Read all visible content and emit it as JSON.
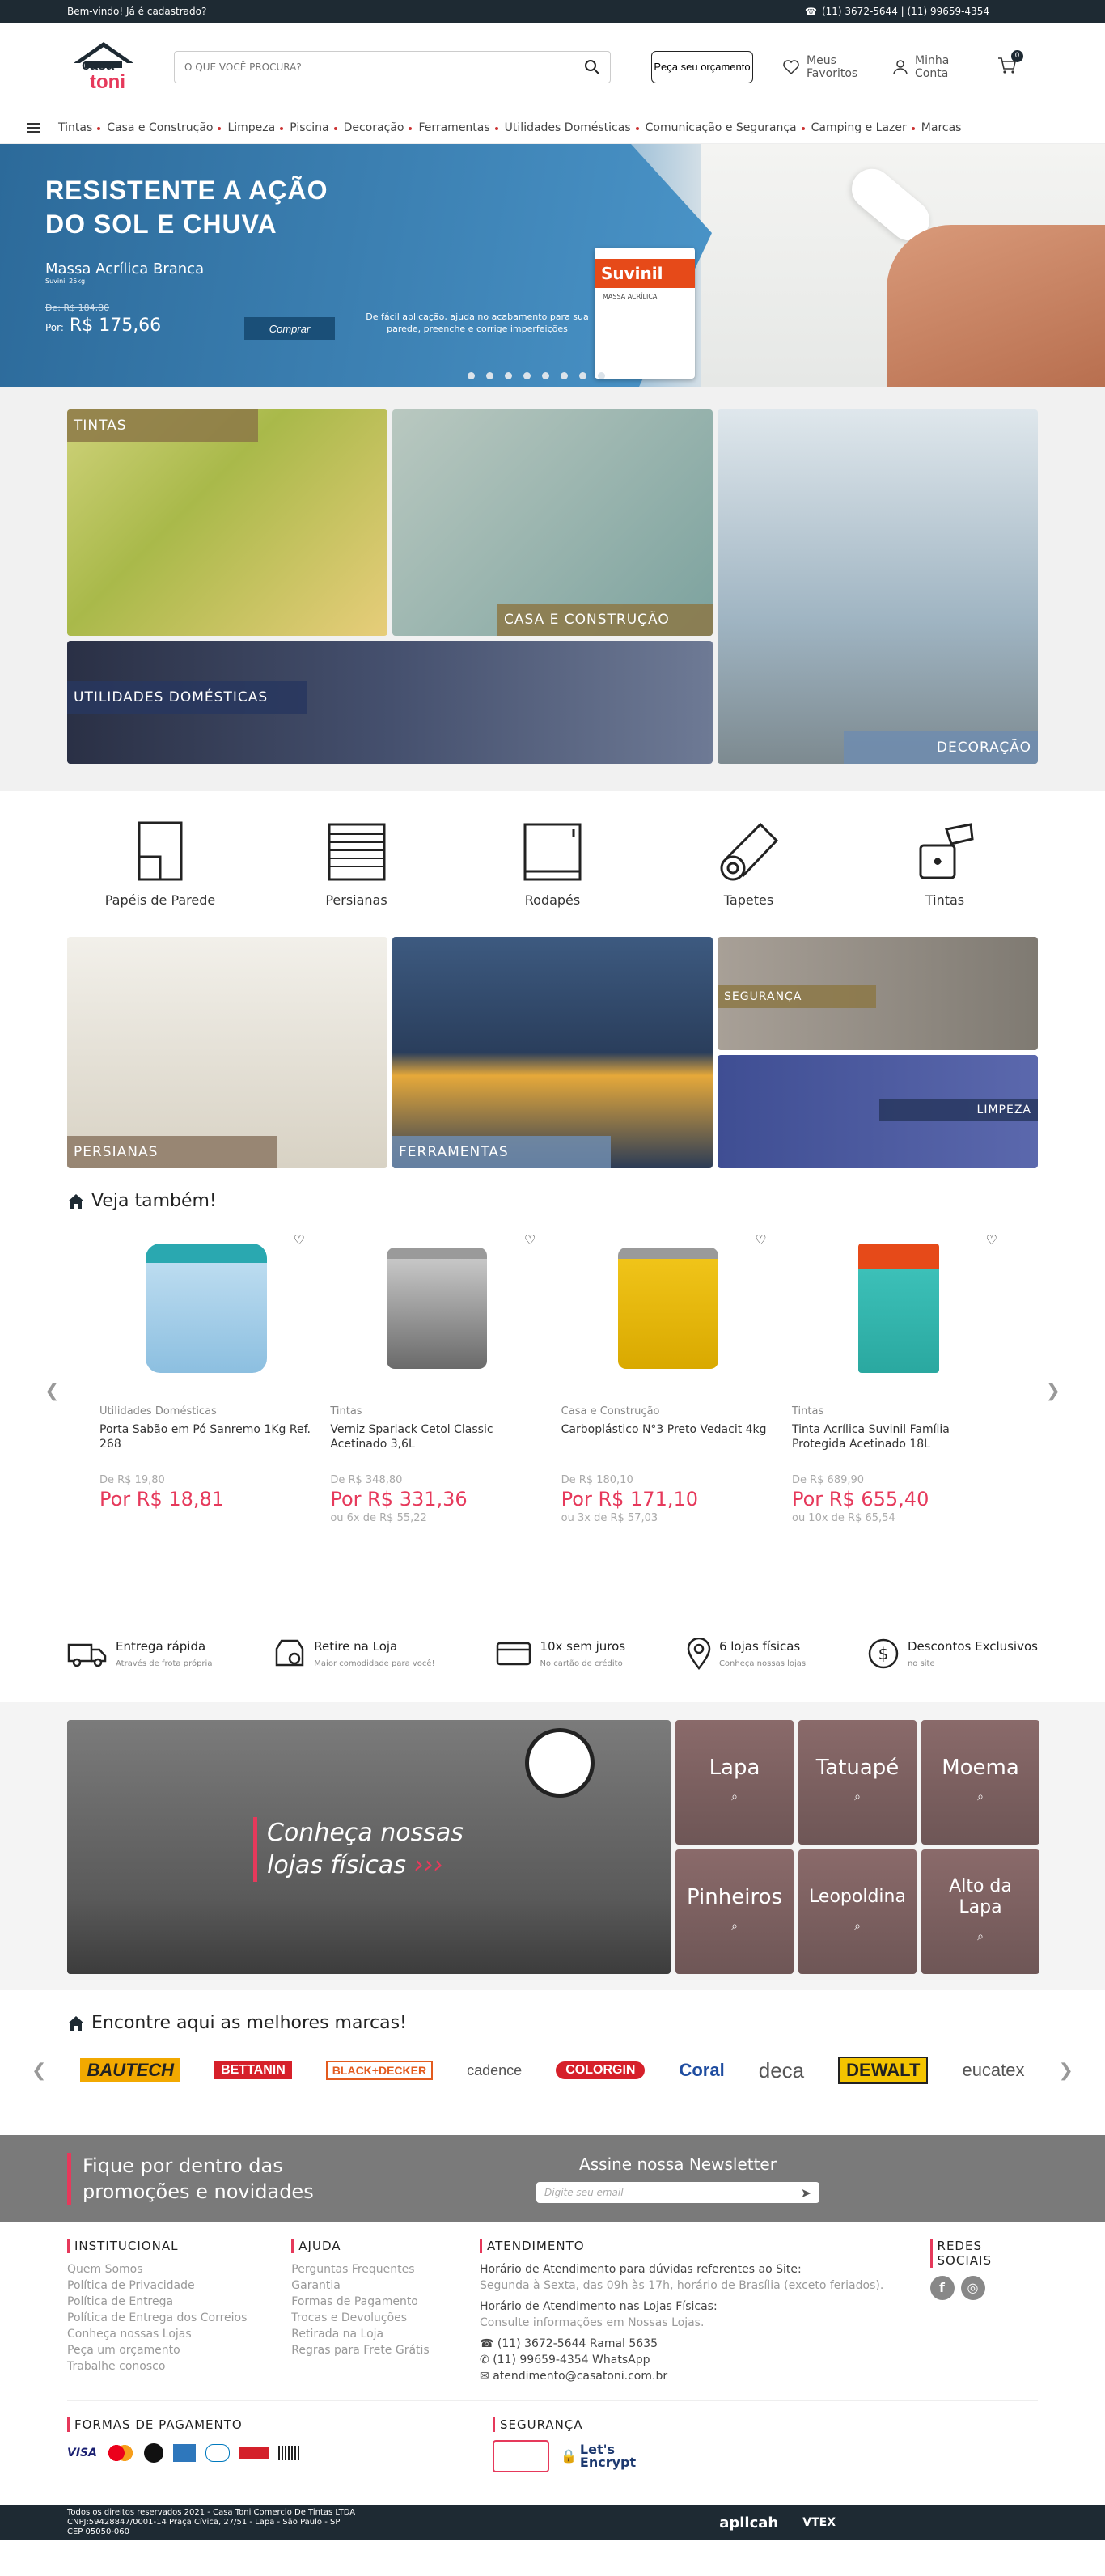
{
  "topbar": {
    "welcome": "Bem-vindo! Já é cadastrado?",
    "phones": "(11) 3672-5644 | (11) 99659-4354"
  },
  "header": {
    "logo_top": "casa",
    "logo_bottom": "toni",
    "search_placeholder": "O QUE VOCÊ PROCURA?",
    "quote_btn": "Peça seu orçamento",
    "favorites": "Meus Favoritos",
    "account": "Minha Conta",
    "cart_count": "0"
  },
  "nav": {
    "items": [
      "Tintas",
      "Casa e Construção",
      "Limpeza",
      "Piscina",
      "Decoração",
      "Ferramentas",
      "Utilidades Domésticas",
      "Comunicação e Segurança",
      "Camping e Lazer",
      "Marcas"
    ]
  },
  "hero": {
    "title_line1": "RESISTENTE A AÇÃO",
    "title_line2": "DO SOL E CHUVA",
    "product": "Massa Acrílica Branca",
    "product_sub": "Suvinil 25kg",
    "old_price": "De: R$ 184,80",
    "price_prefix": "Por:",
    "price": "R$ 175,66",
    "buy": "Comprar",
    "desc": "De fácil aplicação, ajuda no acabamento para sua parede, preenche e corrige imperfeições",
    "can_brand": "Suvinil",
    "can_name": "MASSA ACRÍLICA",
    "slides": 8
  },
  "categories": {
    "tintas": "TINTAS",
    "casa": "CASA E CONSTRUÇÃO",
    "util": "UTILIDADES DOMÉSTICAS",
    "deco": "DECORAÇÃO"
  },
  "icon_cats": [
    "Papéis de Parede",
    "Persianas",
    "Rodapés",
    "Tapetes",
    "Tintas"
  ],
  "categories2": {
    "persianas": "PERSIANAS",
    "ferramentas": "FERRAMENTAS",
    "seguranca": "SEGURANÇA",
    "limpeza": "LIMPEZA"
  },
  "veja": {
    "title": "Veja também!"
  },
  "products": [
    {
      "cat": "Utilidades Domésticas",
      "name": "Porta Sabão em Pó Sanremo 1Kg Ref. 268",
      "old": "De R$ 19,80",
      "new": "Por R$ 18,81",
      "inst": ""
    },
    {
      "cat": "Tintas",
      "name": "Verniz Sparlack Cetol Classic Acetinado 3,6L",
      "old": "De R$ 348,80",
      "new": "Por R$ 331,36",
      "inst": "ou 6x de R$ 55,22"
    },
    {
      "cat": "Casa e Construção",
      "name": "Carboplástico N°3 Preto Vedacit 4kg",
      "old": "De R$ 180,10",
      "new": "Por R$ 171,10",
      "inst": "ou 3x de R$ 57,03"
    },
    {
      "cat": "Tintas",
      "name": "Tinta Acrílica Suvinil Família Protegida Acetinado 18L",
      "old": "De R$ 689,90",
      "new": "Por R$ 655,40",
      "inst": "ou 10x de R$ 65,54"
    }
  ],
  "benefits": [
    {
      "title": "Entrega rápida",
      "sub": "Através de frota própria"
    },
    {
      "title": "Retire na Loja",
      "sub": "Maior comodidade para você!"
    },
    {
      "title": "10x sem juros",
      "sub": "No cartão de crédito"
    },
    {
      "title": "6 lojas físicas",
      "sub": "Conheça nossas lojas"
    },
    {
      "title": "Descontos Exclusivos",
      "sub": "no site"
    }
  ],
  "stores": {
    "headline1": "Conheça nossas",
    "headline2": "lojas físicas",
    "list": [
      "Lapa",
      "Tatuapé",
      "Moema",
      "Pinheiros",
      "Leopoldina",
      "Alto da Lapa"
    ]
  },
  "brands": {
    "title": "Encontre aqui as melhores marcas!",
    "list": [
      "BAUTECH",
      "BETTANIN",
      "BLACK+DECKER",
      "cadence",
      "COLORGIN",
      "Coral",
      "deca",
      "DEWALT",
      "eucatex"
    ]
  },
  "newsletter": {
    "line1": "Fique por dentro das",
    "line2": "promoções e novidades",
    "title": "Assine nossa Newsletter",
    "placeholder": "Digite seu email"
  },
  "footer": {
    "inst_title": "INSTITUCIONAL",
    "inst": [
      "Quem Somos",
      "Política de Privacidade",
      "Política de Entrega",
      "Política de Entrega dos Correios",
      "Conheça nossas Lojas",
      "Peça um orçamento",
      "Trabalhe conosco"
    ],
    "help_title": "AJUDA",
    "help": [
      "Perguntas Frequentes",
      "Garantia",
      "Formas de Pagamento",
      "Trocas e Devoluções",
      "Retirada na Loja",
      "Regras para Frete Grátis"
    ],
    "att_title": "ATENDIMENTO",
    "att1": "Horário de Atendimento para dúvidas referentes ao Site:",
    "att2": "Segunda à Sexta, das 09h às 17h, horário de Brasília (exceto feriados).",
    "att3": "Horário de Atendimento nas Lojas Físicas:",
    "att4": "Consulte informações em Nossas Lojas.",
    "phone1": "(11) 3672-5644 Ramal 5635",
    "phone2": "(11) 99659-4354 WhatsApp",
    "email": "atendimento@casatoni.com.br",
    "social_title": "REDES SOCIAIS",
    "pay_title": "FORMAS DE PAGAMENTO",
    "sec_title": "SEGURANÇA",
    "sec_cert": "Let's Encrypt",
    "copy1": "Todos os direitos reservados 2021 - Casa Toni Comercio De Tintas LTDA",
    "copy2": "CNPJ:59428847/0001-14 Praça Cívica, 27/51 - Lapa - São Paulo - SP",
    "copy3": "CEP 05050-060",
    "partner1": "aplicah",
    "partner2": "VTEX"
  },
  "colors": {
    "dark": "#1e2a33",
    "accent": "#e6395b",
    "blue": "#2f6e9e"
  }
}
